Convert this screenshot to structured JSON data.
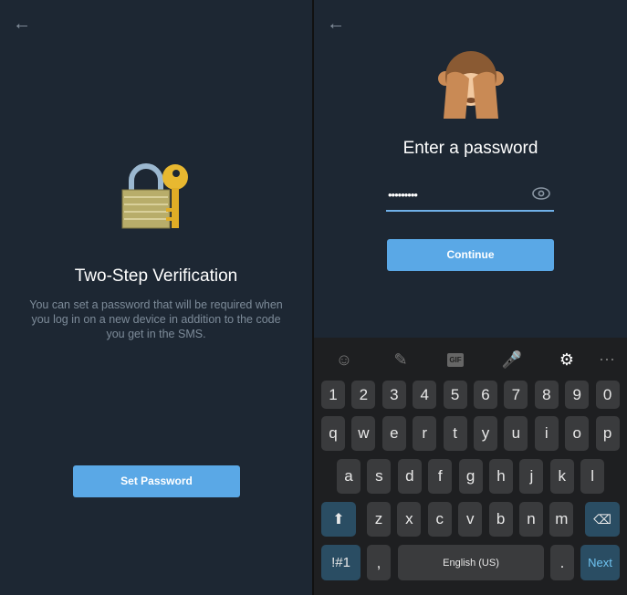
{
  "left": {
    "title": "Two-Step Verification",
    "description": "You can set a password that will be required when you log in on a new device in addition to the code you get in the SMS.",
    "button": "Set Password",
    "emoji": "lock-with-key"
  },
  "right": {
    "emoji": "see-no-evil-monkey",
    "title": "Enter a password",
    "password_value": "•••••••••",
    "button": "Continue"
  },
  "keyboard": {
    "toolbar": [
      "emoji-icon",
      "sticker-icon",
      "gif-icon",
      "microphone-icon",
      "gear-icon",
      "more-icon"
    ],
    "gif_label": "GIF",
    "row1": [
      "1",
      "2",
      "3",
      "4",
      "5",
      "6",
      "7",
      "8",
      "9",
      "0"
    ],
    "row2": [
      "q",
      "w",
      "e",
      "r",
      "t",
      "y",
      "u",
      "i",
      "o",
      "p"
    ],
    "row3": [
      "a",
      "s",
      "d",
      "f",
      "g",
      "h",
      "j",
      "k",
      "l"
    ],
    "row4": [
      "z",
      "x",
      "c",
      "v",
      "b",
      "n",
      "m"
    ],
    "symbols": "!#1",
    "comma": ",",
    "space": "English (US)",
    "period": ".",
    "next": "Next"
  },
  "colors": {
    "background": "#1d2733",
    "accent": "#5aa8e6"
  }
}
